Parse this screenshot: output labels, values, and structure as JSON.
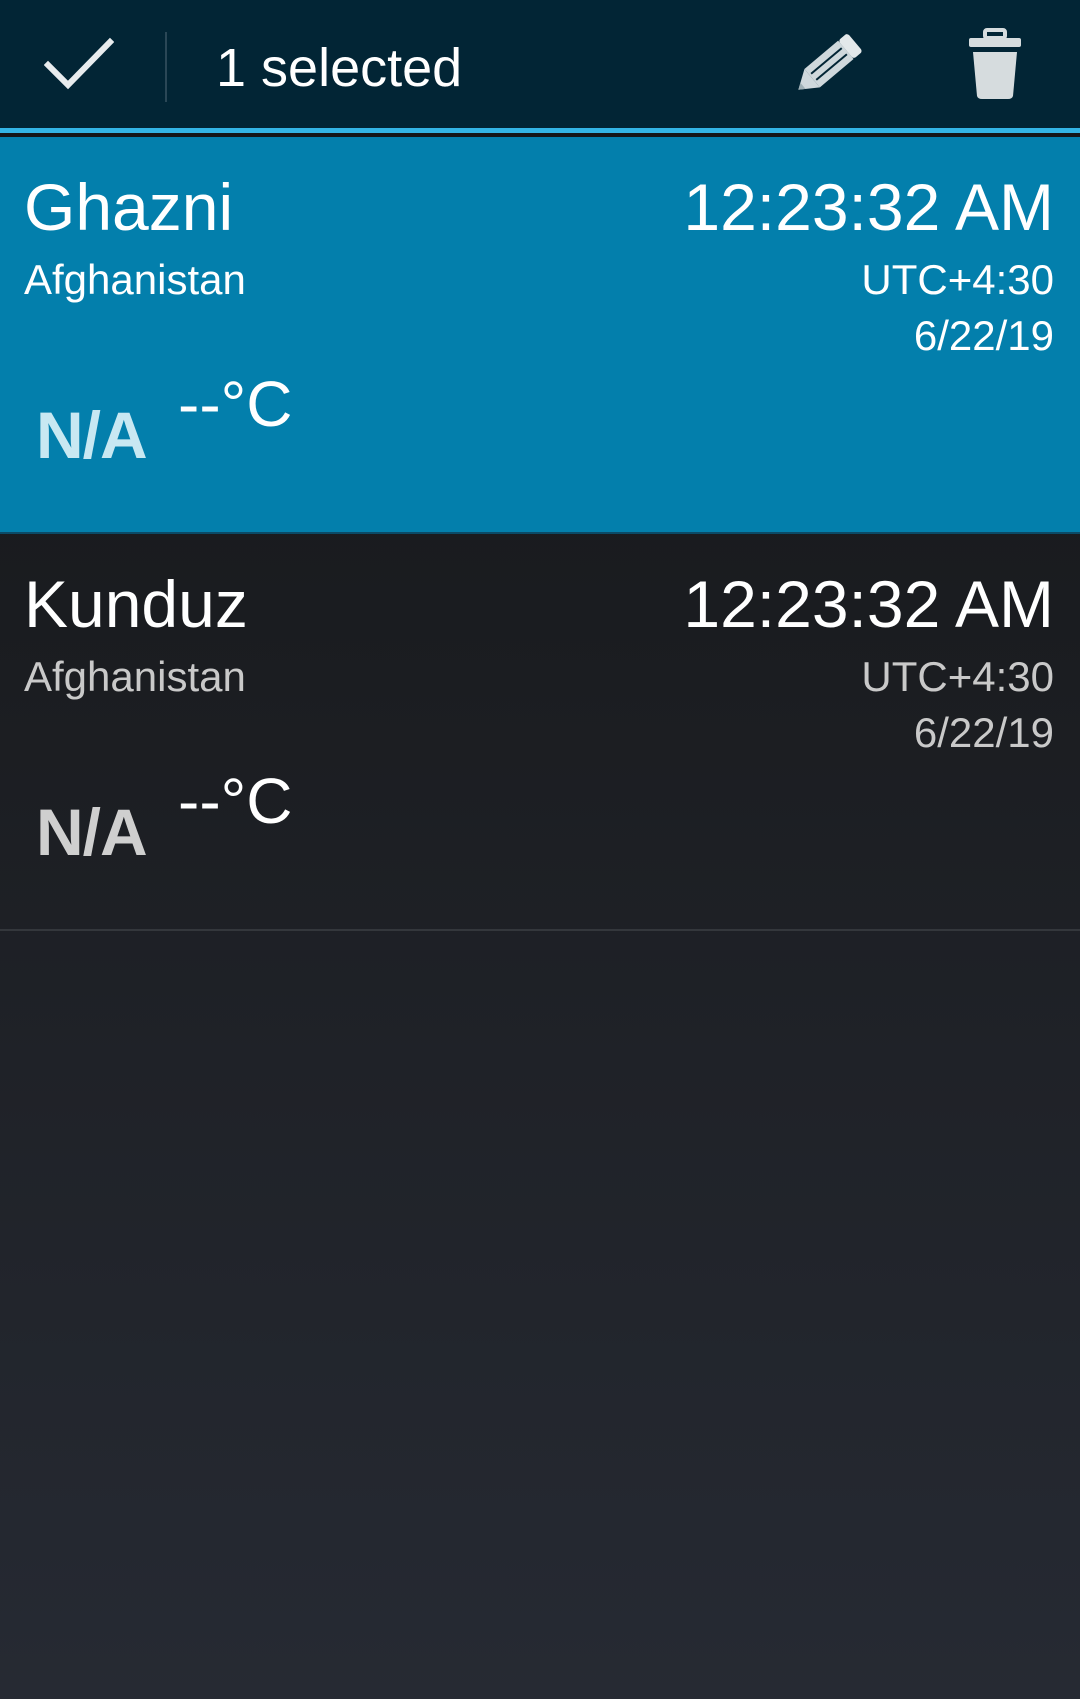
{
  "action_bar": {
    "done_icon": "check-icon",
    "title": "1 selected",
    "edit_icon": "pencil-icon",
    "delete_icon": "trash-icon"
  },
  "colors": {
    "action_bar_bg": "#022535",
    "accent": "#33b5e5",
    "selected_row_bg": "#037fac"
  },
  "clocks": [
    {
      "city": "Ghazni",
      "country": "Afghanistan",
      "time": "12:23:32 AM",
      "utc_offset": "UTC+4:30",
      "date": "6/22/19",
      "weather": "N/A",
      "temperature": "--°C",
      "selected": true
    },
    {
      "city": "Kunduz",
      "country": "Afghanistan",
      "time": "12:23:32 AM",
      "utc_offset": "UTC+4:30",
      "date": "6/22/19",
      "weather": "N/A",
      "temperature": "--°C",
      "selected": false
    }
  ]
}
